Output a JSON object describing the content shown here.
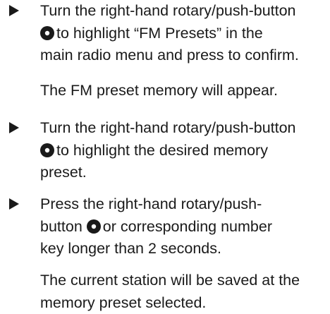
{
  "steps": [
    {
      "line1": "Turn the right-hand rotary/push-button",
      "line2": "to highlight “FM Presets” in the",
      "line3": "main radio menu and press to confirm.",
      "result": "The FM preset memory will appear."
    },
    {
      "line1": "Turn the right-hand rotary/push-button",
      "line2": "to highlight the desired memory",
      "line3": "preset."
    },
    {
      "line1": "Press the right-hand rotary/push-",
      "line2a": "button",
      "line2b": "or corresponding number",
      "line3": "key longer than 2 seconds.",
      "result1": "The current station will be saved at the",
      "result2": "memory preset selected."
    }
  ],
  "icons": {
    "bullet": "triangle-right-icon",
    "knob": "rotary-push-button-icon"
  },
  "colors": {
    "text": "#1a1a1a",
    "background": "#ffffff"
  }
}
